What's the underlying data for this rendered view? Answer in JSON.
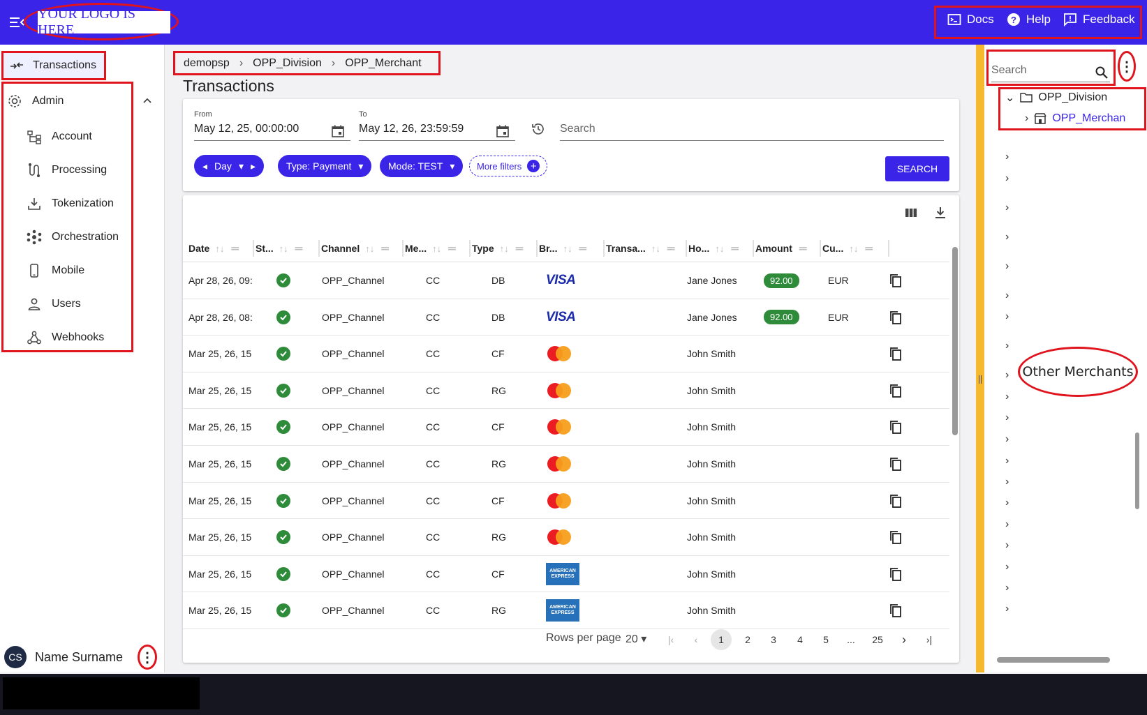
{
  "header": {
    "logo_text": "YOUR LOGO IS HERE",
    "links": [
      {
        "label": "Docs",
        "icon": "terminal-icon"
      },
      {
        "label": "Help",
        "icon": "help-circle-icon"
      },
      {
        "label": "Feedback",
        "icon": "feedback-icon"
      }
    ]
  },
  "sidebar": {
    "transactions_label": "Transactions",
    "admin_label": "Admin",
    "admin_items": [
      {
        "label": "Account",
        "icon": "hierarchy-icon"
      },
      {
        "label": "Processing",
        "icon": "route-icon"
      },
      {
        "label": "Tokenization",
        "icon": "download-tray-icon"
      },
      {
        "label": "Orchestration",
        "icon": "hub-icon"
      },
      {
        "label": "Mobile",
        "icon": "phone-icon"
      },
      {
        "label": "Users",
        "icon": "user-icon"
      },
      {
        "label": "Webhooks",
        "icon": "webhook-icon"
      }
    ],
    "user": {
      "initials": "CS",
      "name": "Name Surname"
    }
  },
  "breadcrumb": [
    "demopsp",
    "OPP_Division",
    "OPP_Merchant"
  ],
  "page_title": "Transactions",
  "filters": {
    "from_label": "From",
    "from_value": "May 12, 25, 00:00:00",
    "to_label": "To",
    "to_value": "May 12, 26, 23:59:59",
    "search_placeholder": "Search",
    "chips": [
      "Day",
      "Type: Payment",
      "Mode: TEST"
    ],
    "more_filters": "More filters",
    "search_button": "SEARCH"
  },
  "table": {
    "columns": [
      "Date",
      "St...",
      "Channel",
      "Me...",
      "Type",
      "Br...",
      "Transa...",
      "Ho...",
      "Amount",
      "Cu..."
    ],
    "rows": [
      {
        "date": "Apr 28, 26, 09:",
        "channel": "OPP_Channel",
        "method": "CC",
        "type": "DB",
        "brand": "visa",
        "holder": "Jane Jones",
        "amount": "92.00",
        "currency": "EUR"
      },
      {
        "date": "Apr 28, 26, 08:",
        "channel": "OPP_Channel",
        "method": "CC",
        "type": "DB",
        "brand": "visa",
        "holder": "Jane Jones",
        "amount": "92.00",
        "currency": "EUR"
      },
      {
        "date": "Mar 25, 26, 15",
        "channel": "OPP_Channel",
        "method": "CC",
        "type": "CF",
        "brand": "mastercard",
        "holder": "John Smith",
        "amount": "",
        "currency": ""
      },
      {
        "date": "Mar 25, 26, 15",
        "channel": "OPP_Channel",
        "method": "CC",
        "type": "RG",
        "brand": "mastercard",
        "holder": "John Smith",
        "amount": "",
        "currency": ""
      },
      {
        "date": "Mar 25, 26, 15",
        "channel": "OPP_Channel",
        "method": "CC",
        "type": "CF",
        "brand": "mastercard",
        "holder": "John Smith",
        "amount": "",
        "currency": ""
      },
      {
        "date": "Mar 25, 26, 15",
        "channel": "OPP_Channel",
        "method": "CC",
        "type": "RG",
        "brand": "mastercard",
        "holder": "John Smith",
        "amount": "",
        "currency": ""
      },
      {
        "date": "Mar 25, 26, 15",
        "channel": "OPP_Channel",
        "method": "CC",
        "type": "CF",
        "brand": "mastercard",
        "holder": "John Smith",
        "amount": "",
        "currency": ""
      },
      {
        "date": "Mar 25, 26, 15",
        "channel": "OPP_Channel",
        "method": "CC",
        "type": "RG",
        "brand": "mastercard",
        "holder": "John Smith",
        "amount": "",
        "currency": ""
      },
      {
        "date": "Mar 25, 26, 15",
        "channel": "OPP_Channel",
        "method": "CC",
        "type": "CF",
        "brand": "amex",
        "holder": "John Smith",
        "amount": "",
        "currency": ""
      },
      {
        "date": "Mar 25, 26, 15",
        "channel": "OPP_Channel",
        "method": "CC",
        "type": "RG",
        "brand": "amex",
        "holder": "John Smith",
        "amount": "",
        "currency": ""
      }
    ],
    "brand_labels": {
      "visa": "VISA",
      "amex_1": "AMERICAN",
      "amex_2": "EXPRESS"
    },
    "pagination": {
      "rows_per_page_label": "Rows per page",
      "rows_per_page": "20",
      "pages": [
        "1",
        "2",
        "3",
        "4",
        "5",
        "...",
        "25"
      ],
      "current": "1"
    }
  },
  "tree": {
    "search_placeholder": "Search",
    "division": "OPP_Division",
    "merchant": "OPP_Merchan",
    "other_label": "Other Merchants"
  },
  "colors": {
    "accent": "#3a24e8",
    "annotation": "#e0141c",
    "success": "#2e8b3a",
    "splitter": "#f5b82e"
  }
}
